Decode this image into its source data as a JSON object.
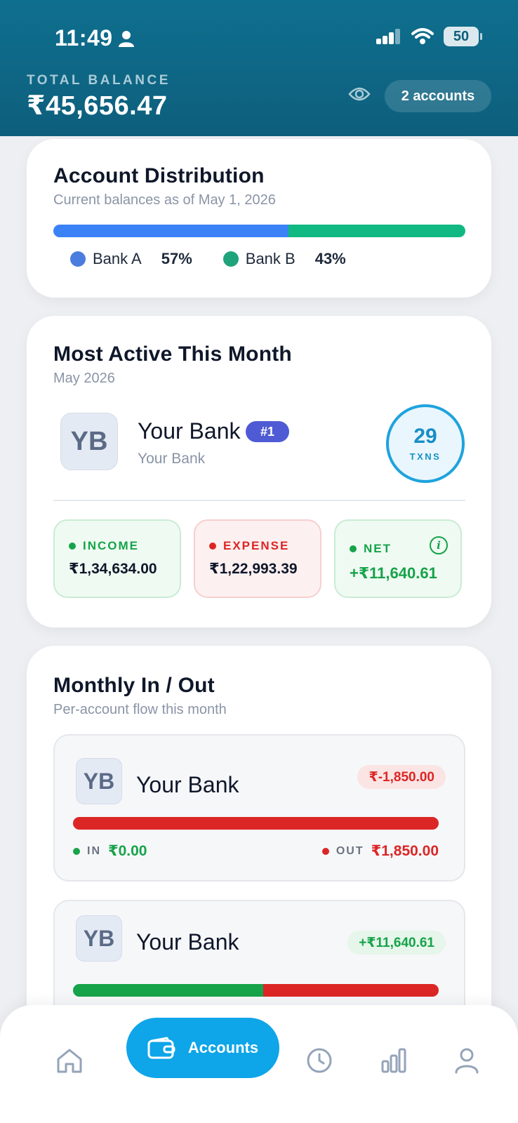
{
  "status_bar": {
    "time": "11:49",
    "battery": "50"
  },
  "header": {
    "total_label": "TOTAL BALANCE",
    "total_value": "₹45,656.47",
    "accounts_pill": "2 accounts"
  },
  "distribution": {
    "title": "Account Distribution",
    "subtitle": "Current balances as of May 1, 2026",
    "segments": [
      {
        "name": "Bank A",
        "pct_label": "57%",
        "share": 0.57,
        "color": "#3b82f6"
      },
      {
        "name": "Bank B",
        "pct_label": "43%",
        "share": 0.43,
        "color": "#10b981"
      }
    ]
  },
  "most_active": {
    "title": "Most Active This Month",
    "subtitle": "May 2026",
    "bank_initials": "YB",
    "bank_name": "Your Bank",
    "bank_sub": "Your Bank",
    "rank": "#1",
    "txn_count": "29",
    "txn_label": "TXNS",
    "stats": {
      "income": {
        "label": "INCOME",
        "value": "₹1,34,634.00"
      },
      "expense": {
        "label": "EXPENSE",
        "value": "₹1,22,993.39"
      },
      "net": {
        "label": "NET",
        "value": "+₹11,640.61"
      }
    }
  },
  "monthly": {
    "title": "Monthly In / Out",
    "subtitle": "Per-account flow this month",
    "accounts": [
      {
        "initials": "YB",
        "name": "Your Bank",
        "net": "₹-1,850.00",
        "in_label": "IN",
        "in_value": "₹0.00",
        "out_label": "OUT",
        "out_value": "₹1,850.00",
        "in_share": 0.0
      },
      {
        "initials": "YB",
        "name": "Your Bank",
        "net": "+₹11,640.61",
        "in_share": 0.52
      }
    ]
  },
  "nav": {
    "active_label": "Accounts"
  },
  "colors": {
    "header": "#0d5f7c",
    "income": "#16a34a",
    "expense": "#dc2626",
    "accent": "#0ea5e9"
  }
}
